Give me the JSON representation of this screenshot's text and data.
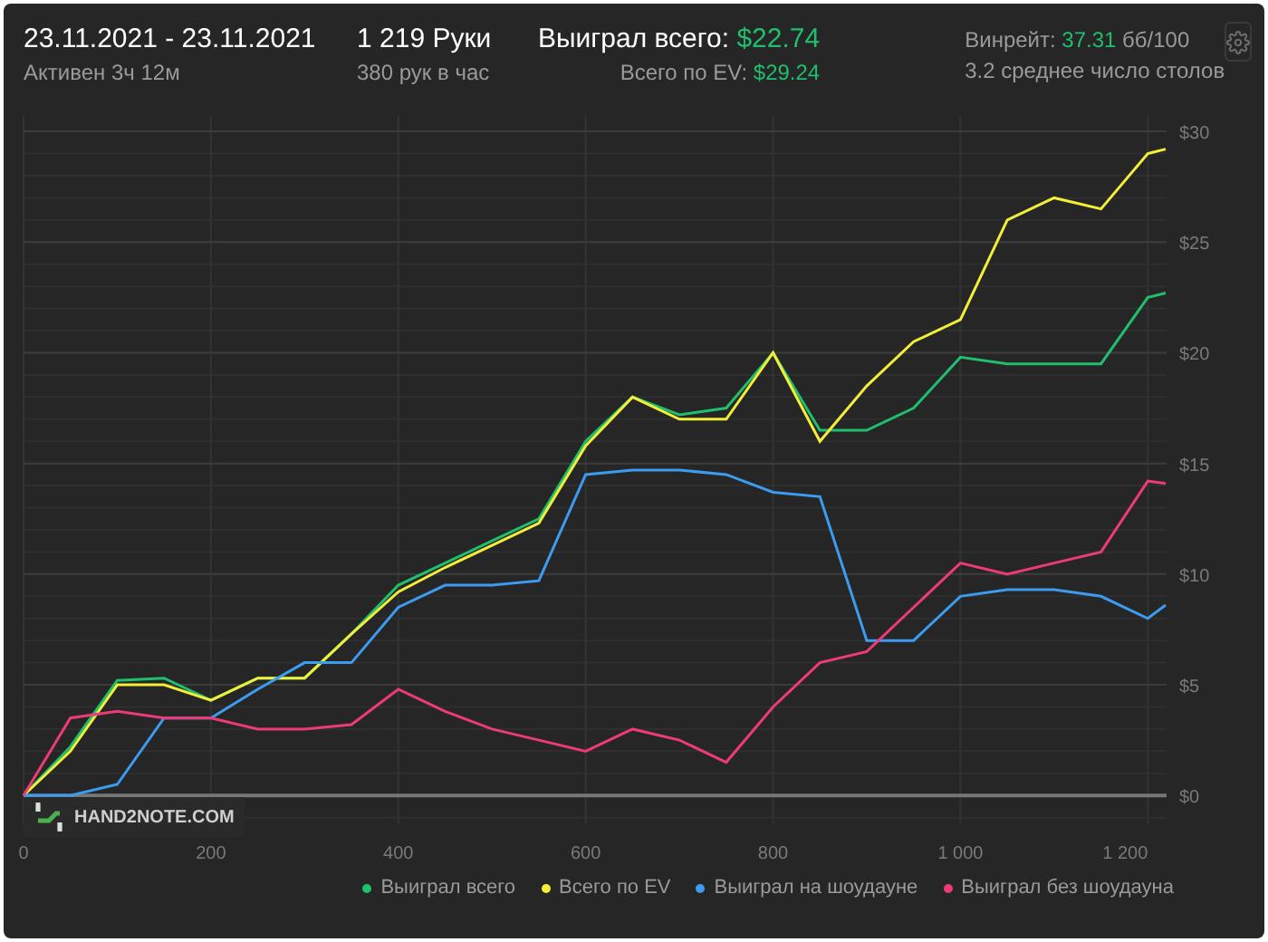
{
  "header": {
    "date_range": "23.11.2021 - 23.11.2021",
    "active": "Активен 3ч 12м",
    "hands": "1 219 Руки",
    "hands_per_hour": "380 рук в час",
    "won_label": "Выиграл всего:",
    "won_value": "$22.74",
    "ev_label": "Всего по EV:",
    "ev_value": "$29.24",
    "winrate_label": "Винрейт:",
    "winrate_value": "37.31",
    "winrate_unit": "бб/100",
    "tables": "3.2 среднее число столов"
  },
  "chart": {
    "logo": "HAND2NOTE.COM",
    "chart_data": {
      "type": "line",
      "x": [
        0,
        50,
        100,
        150,
        200,
        250,
        300,
        350,
        400,
        450,
        500,
        550,
        600,
        650,
        700,
        750,
        800,
        850,
        900,
        950,
        1000,
        1050,
        1100,
        1150,
        1200,
        1219
      ],
      "series": [
        {
          "name": "Выиграл всего",
          "color": "#1fbf6e",
          "values": [
            0,
            2.2,
            5.2,
            5.3,
            4.3,
            5.3,
            5.3,
            7.3,
            9.5,
            10.5,
            11.5,
            12.5,
            16,
            18,
            17.2,
            17.5,
            20,
            16.5,
            16.5,
            17.5,
            19.8,
            19.5,
            19.5,
            19.5,
            22.5,
            22.7
          ]
        },
        {
          "name": "Всего по EV",
          "color": "#f2ee3a",
          "values": [
            0,
            2,
            5,
            5,
            4.3,
            5.3,
            5.3,
            7.3,
            9.2,
            10.3,
            11.3,
            12.3,
            15.8,
            18,
            17,
            17,
            20,
            16,
            18.5,
            20.5,
            21.5,
            26,
            27,
            26.5,
            29,
            29.2
          ]
        },
        {
          "name": "Выиграл на шоудауне",
          "color": "#3b9cf0",
          "values": [
            0,
            0,
            0.5,
            3.5,
            3.5,
            4.8,
            6,
            6,
            8.5,
            9.5,
            9.5,
            9.7,
            14.5,
            14.7,
            14.7,
            14.5,
            13.7,
            13.5,
            7,
            7,
            9,
            9.3,
            9.3,
            9,
            8,
            8.6
          ]
        },
        {
          "name": "Выиграл без шоудауна",
          "color": "#ec3b77",
          "values": [
            0,
            3.5,
            3.8,
            3.5,
            3.5,
            3,
            3,
            3.2,
            4.8,
            3.8,
            3,
            2.5,
            2,
            3,
            2.5,
            1.5,
            4,
            6,
            6.5,
            8.5,
            10.5,
            10,
            10.5,
            11,
            14.2,
            14.1
          ]
        }
      ],
      "grid": true,
      "xlim": [
        0,
        1220
      ],
      "ylim": [
        -1.3,
        30.7
      ],
      "xticks": [
        0,
        200,
        400,
        600,
        800,
        {
          "value": 1000,
          "label": "1 000"
        },
        {
          "value": 1200,
          "label": "1 200"
        }
      ],
      "yticks": [
        {
          "value": 0,
          "label": "$0"
        },
        {
          "value": 5,
          "label": "$5"
        },
        {
          "value": 10,
          "label": "$10"
        },
        {
          "value": 15,
          "label": "$15"
        },
        {
          "value": 20,
          "label": "$20"
        },
        {
          "value": 25,
          "label": "$25"
        },
        {
          "value": 30,
          "label": "$30"
        }
      ]
    }
  }
}
